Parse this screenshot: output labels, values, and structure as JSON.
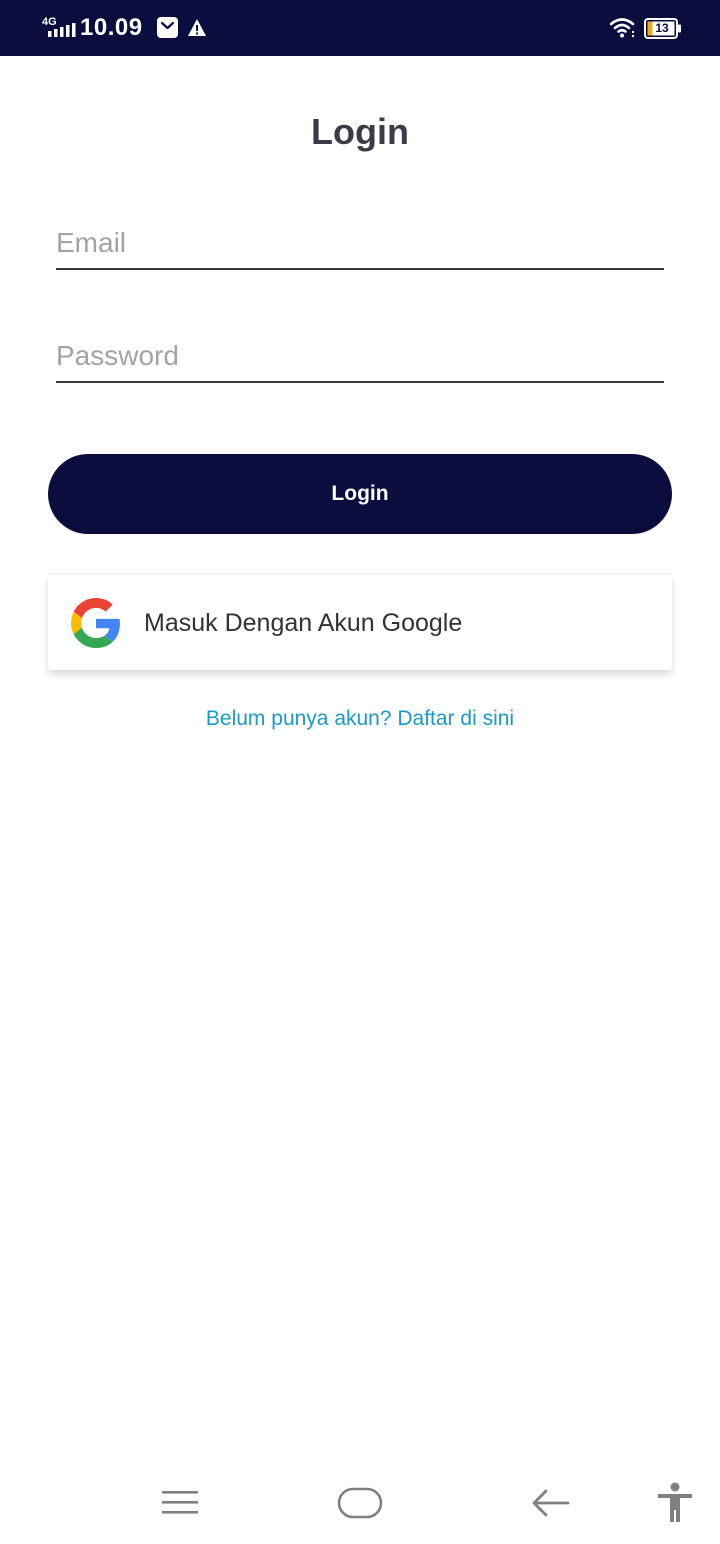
{
  "status_bar": {
    "network": "4G",
    "time": "10.09",
    "battery": "13",
    "icons": [
      "signal-icon",
      "message-icon",
      "warning-icon",
      "wifi-icon",
      "battery-icon"
    ]
  },
  "page": {
    "title": "Login"
  },
  "form": {
    "email_placeholder": "Email",
    "email_value": "",
    "password_placeholder": "Password",
    "password_value": "",
    "login_label": "Login",
    "google_label": "Masuk Dengan Akun Google",
    "register_link": "Belum punya akun? Daftar di sini"
  },
  "nav_bar": {
    "icons": [
      "menu-icon",
      "home-icon",
      "back-icon",
      "accessibility-icon"
    ]
  },
  "colors": {
    "primary": "#0b0d3f",
    "link": "#1b9bc4",
    "title": "#3b3b48",
    "google_red": "#ea4335",
    "google_yellow": "#fbbc05",
    "google_green": "#34a853",
    "google_blue": "#4285f4"
  }
}
